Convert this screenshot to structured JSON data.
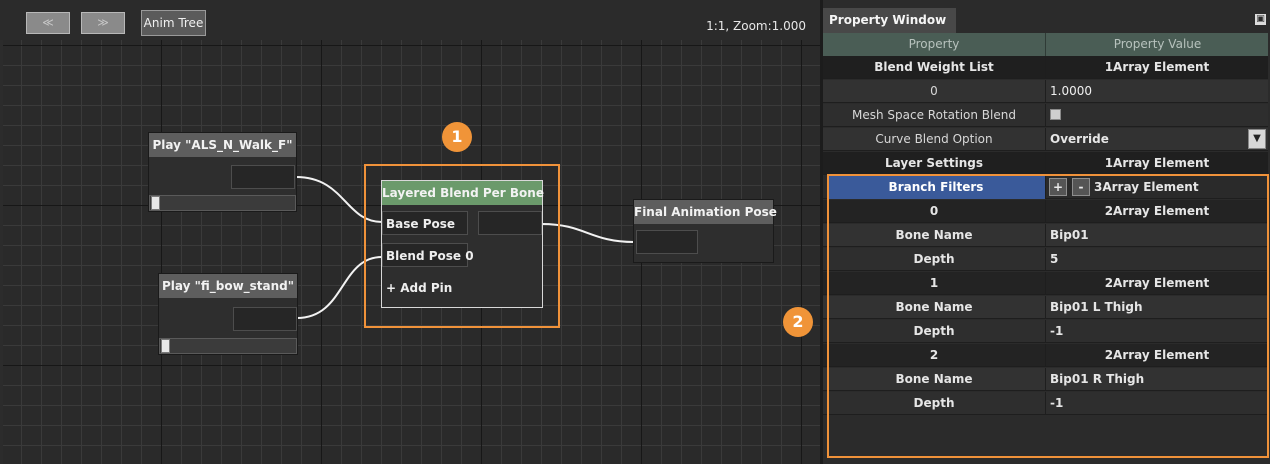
{
  "toolbar": {
    "prev_label": "≪",
    "next_label": "≫",
    "tab_label": "Anim Tree",
    "zoom_text": "1:1, Zoom:1.000"
  },
  "graph": {
    "node_walk": {
      "title": "Play \"ALS_N_Walk_F\""
    },
    "node_bow": {
      "title": "Play \"fi_bow_stand\""
    },
    "node_layered": {
      "title": "Layered Blend Per Bone",
      "pin_base": "Base Pose",
      "pin_blend": "Blend Pose 0",
      "add_pin": "+ Add Pin",
      "title_color": "#6b9a6b"
    },
    "node_final": {
      "title": "Final Animation Pose"
    },
    "badge1": "1",
    "badge2": "2",
    "highlight_color": "#f0923a"
  },
  "property_window": {
    "title": "Property Window",
    "header_property": "Property",
    "header_value": "Property Value",
    "rows": [
      {
        "name": "Blend Weight List",
        "value": "1Array Element"
      },
      {
        "name": "0",
        "value": "1.0000"
      },
      {
        "name": "Mesh Space Rotation Blend",
        "value": ""
      },
      {
        "name": "Curve Blend Option",
        "value": "Override"
      },
      {
        "name": "Layer Settings",
        "value": "1Array Element"
      },
      {
        "name": "Branch Filters",
        "value": "3Array Element",
        "plus": "+",
        "minus": "-"
      },
      {
        "name": "0",
        "value": "2Array Element"
      },
      {
        "name": "Bone Name",
        "value": "Bip01"
      },
      {
        "name": "Depth",
        "value": "5"
      },
      {
        "name": "1",
        "value": "2Array Element"
      },
      {
        "name": "Bone Name",
        "value": "Bip01 L Thigh"
      },
      {
        "name": "Depth",
        "value": "-1"
      },
      {
        "name": "2",
        "value": "2Array Element"
      },
      {
        "name": "Bone Name",
        "value": "Bip01 R Thigh"
      },
      {
        "name": "Depth",
        "value": "-1"
      }
    ]
  }
}
